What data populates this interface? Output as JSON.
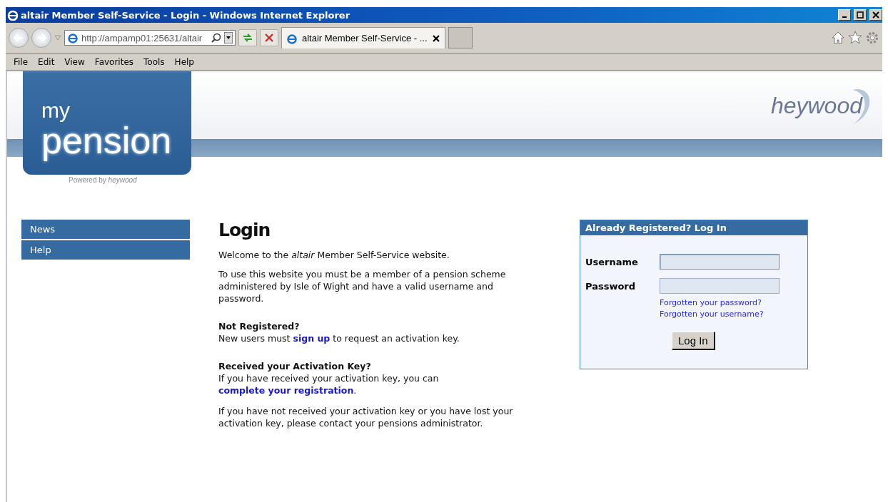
{
  "window": {
    "title": "altair Member Self-Service - Login - Windows Internet Explorer"
  },
  "address_bar": {
    "url": "http://ampamp01:25631/altair"
  },
  "tabs": [
    {
      "label": "altair Member Self-Service - ...",
      "selected": true
    }
  ],
  "menu": [
    "File",
    "Edit",
    "View",
    "Favorites",
    "Tools",
    "Help"
  ],
  "header": {
    "logo_small": "my",
    "logo_large": "pension",
    "powered_by": "Powered by *heywood*",
    "brand": "heywood"
  },
  "sidebar": {
    "items": [
      {
        "label": "News"
      },
      {
        "label": "Help"
      }
    ]
  },
  "main": {
    "title": "Login",
    "paragraphs": [
      {
        "kind": "text",
        "text": "Welcome to the *altair* Member Self-Service website."
      },
      {
        "kind": "text",
        "text": "To use this website you must be a member of a pension scheme administered by Isle of Wight and have a valid username and password."
      },
      {
        "kind": "link",
        "heading": "Not Registered?",
        "before": "New users must",
        "link": "sign up",
        "after": "to request an activation key."
      },
      {
        "kind": "link",
        "heading": "Received your Activation Key?",
        "before": "If you have received your activation key, you can",
        "link": "complete your registration",
        "after": "."
      },
      {
        "kind": "text",
        "text": "If you have not received your activation key or you have lost your activation key, please contact your pensions administrator."
      }
    ]
  },
  "login": {
    "title": "Already Registered? Log In",
    "fields": [
      {
        "label": "Username",
        "focused": true
      },
      {
        "label": "Password",
        "focused": false
      }
    ],
    "links": [
      "Forgotten your password?",
      "Forgotten your username?"
    ],
    "button": "Log In"
  }
}
